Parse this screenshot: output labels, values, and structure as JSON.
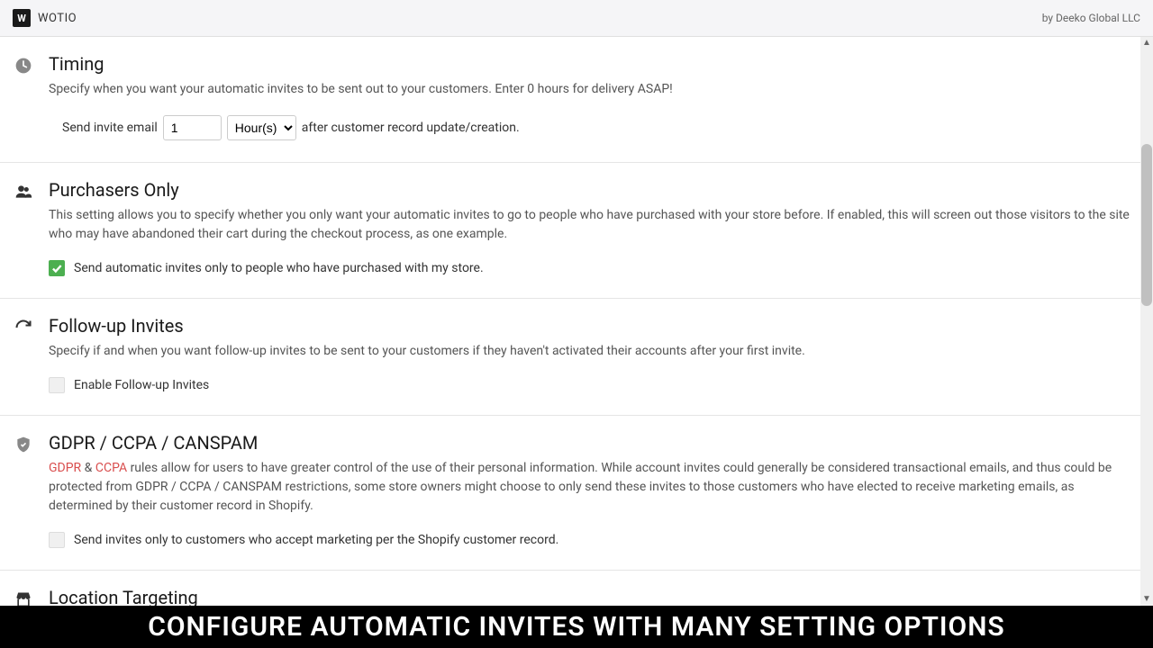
{
  "header": {
    "app_name": "WOTIO",
    "logo_letter": "W",
    "byline": "by Deeko Global LLC"
  },
  "sections": {
    "timing": {
      "title": "Timing",
      "desc": "Specify when you want your automatic invites to be sent out to your customers. Enter 0 hours for delivery ASAP!",
      "prefix": "Send invite email",
      "value": "1",
      "unit": "Hour(s)",
      "suffix": "after customer record update/creation."
    },
    "purchasers": {
      "title": "Purchasers Only",
      "desc": "This setting allows you to specify whether you only want your automatic invites to go to people who have purchased with your store before. If enabled, this will screen out those visitors to the site who may have abandoned their cart during the checkout process, as one example.",
      "checkbox_label": "Send automatic invites only to people who have purchased with my store.",
      "checked": true
    },
    "followup": {
      "title": "Follow-up Invites",
      "desc": "Specify if and when you want follow-up invites to be sent to your customers if they haven't activated their accounts after your first invite.",
      "checkbox_label": "Enable Follow-up Invites",
      "checked": false
    },
    "gdpr": {
      "title": "GDPR / CCPA / CANSPAM",
      "link1": "GDPR",
      "amp": " & ",
      "link2": "CCPA",
      "desc_rest": " rules allow for users to have greater control of the use of their personal information. While account invites could generally be considered transactional emails, and thus could be protected from GDPR / CCPA / CANSPAM restrictions, some store owners might choose to only send these invites to those customers who have elected to receive marketing emails, as determined by their customer record in Shopify.",
      "checkbox_label": "Send invites only to customers who accept marketing per the Shopify customer record.",
      "checked": false
    },
    "location": {
      "title": "Location Targeting"
    }
  },
  "banner": "CONFIGURE AUTOMATIC INVITES WITH MANY SETTING OPTIONS"
}
